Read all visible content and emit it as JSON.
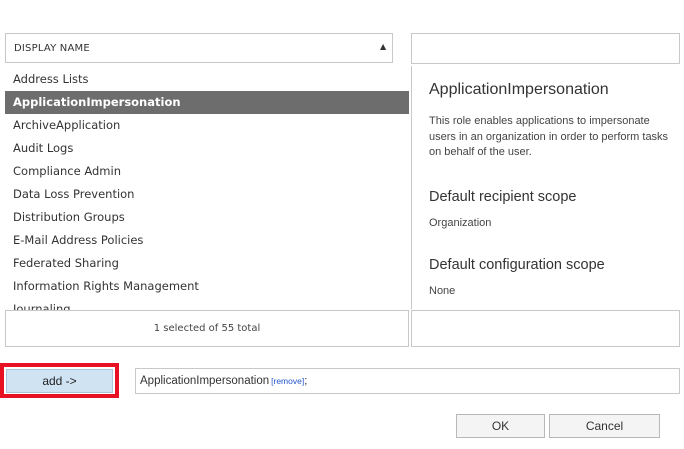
{
  "list": {
    "column_header": "DISPLAY NAME",
    "sort_icon": "sort-ascending-icon",
    "items": [
      "Address Lists",
      "ApplicationImpersonation",
      "ArchiveApplication",
      "Audit Logs",
      "Compliance Admin",
      "Data Loss Prevention",
      "Distribution Groups",
      "E-Mail Address Policies",
      "Federated Sharing",
      "Information Rights Management",
      "Journaling"
    ],
    "selected_index": 1,
    "status": "1 selected of 55 total"
  },
  "search": {
    "value": ""
  },
  "details": {
    "title": "ApplicationImpersonation",
    "description": "This role enables applications to impersonate users in an organization in order to perform tasks on behalf of the user.",
    "recipient_scope_heading": "Default recipient scope",
    "recipient_scope_value": "Organization",
    "config_scope_heading": "Default configuration scope",
    "config_scope_value": "None"
  },
  "add_button": {
    "label": "add ->",
    "highlight_color": "#e81123",
    "background": "#cfe3f3"
  },
  "selected_field": {
    "item": "ApplicationImpersonation",
    "remove_label": "[remove]",
    "separator": ";"
  },
  "buttons": {
    "ok": "OK",
    "cancel": "Cancel"
  },
  "colors": {
    "selected_row": "#6d6d6d",
    "link": "#2255cc",
    "border": "#c8c8c8"
  }
}
